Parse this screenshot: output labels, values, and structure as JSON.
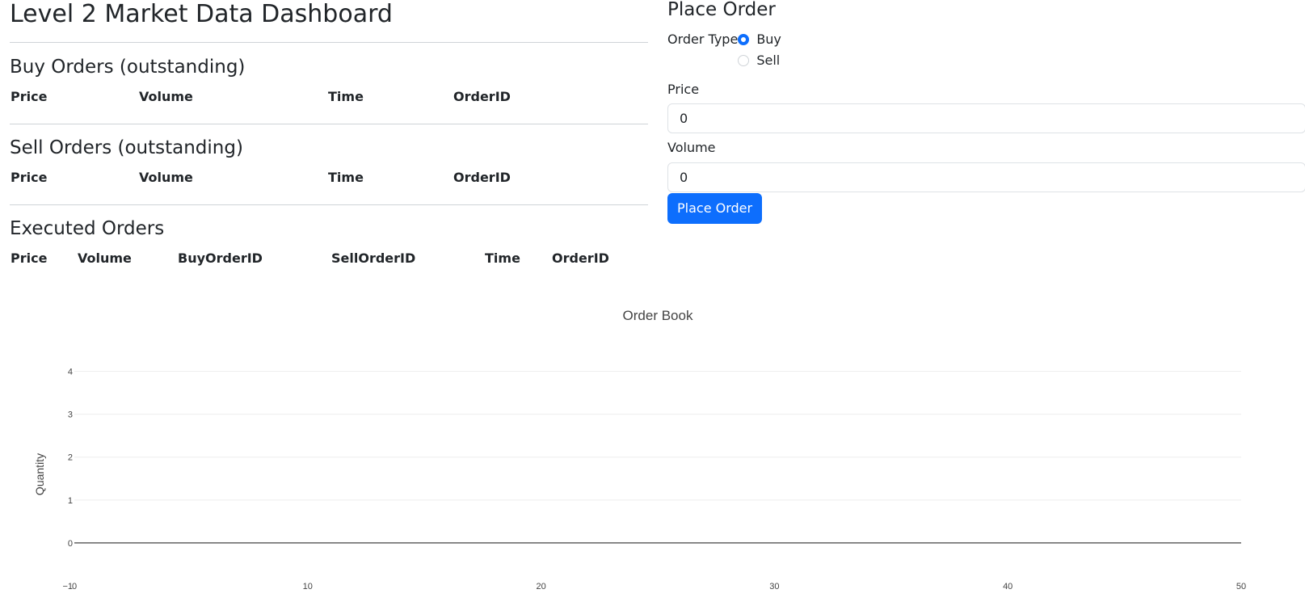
{
  "dashboard": {
    "title": "Level 2 Market Data Dashboard",
    "buy_section": {
      "title": "Buy Orders (outstanding)",
      "columns": [
        "Price",
        "Volume",
        "Time",
        "OrderID"
      ]
    },
    "sell_section": {
      "title": "Sell Orders (outstanding)",
      "columns": [
        "Price",
        "Volume",
        "Time",
        "OrderID"
      ]
    },
    "executed_section": {
      "title": "Executed Orders",
      "columns": [
        "Price",
        "Volume",
        "BuyOrderID",
        "SellOrderID",
        "Time",
        "OrderID"
      ]
    }
  },
  "order_form": {
    "title": "Place Order",
    "order_type_label": "Order Type",
    "options": [
      "Buy",
      "Sell"
    ],
    "selected_option": "Buy",
    "price_label": "Price",
    "price_value": "0",
    "volume_label": "Volume",
    "volume_value": "0",
    "submit_label": "Place Order",
    "accent_color": "#0d6efd"
  },
  "chart_data": {
    "type": "line",
    "title": "Order Book",
    "xlabel": "",
    "ylabel": "Quantity",
    "xlim": [
      0,
      50
    ],
    "ylim": [
      -1,
      4.5
    ],
    "xticks": [
      0,
      10,
      20,
      30,
      40,
      50
    ],
    "yticks": [
      -1,
      0,
      1,
      2,
      3,
      4
    ],
    "series": [],
    "grid": true,
    "legend": "none"
  }
}
